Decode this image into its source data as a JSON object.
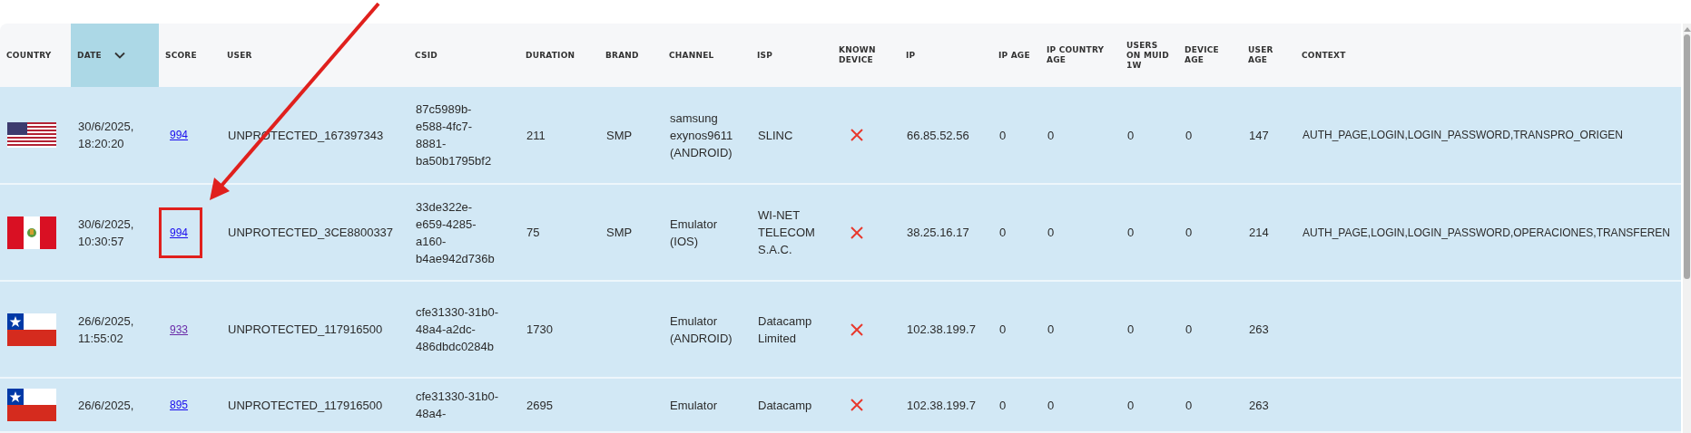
{
  "table": {
    "columns": [
      {
        "label": "COUNTRY",
        "sorted": false
      },
      {
        "label": "DATE",
        "sorted": true
      },
      {
        "label": "SCORE",
        "sorted": false
      },
      {
        "label": "USER",
        "sorted": false
      },
      {
        "label": "CSID",
        "sorted": false
      },
      {
        "label": "DURATION",
        "sorted": false
      },
      {
        "label": "BRAND",
        "sorted": false
      },
      {
        "label": "CHANNEL",
        "sorted": false
      },
      {
        "label": "ISP",
        "sorted": false
      },
      {
        "label": "KNOWN DEVICE",
        "sorted": false
      },
      {
        "label": "IP",
        "sorted": false
      },
      {
        "label": "IP AGE",
        "sorted": false
      },
      {
        "label": "IP COUNTRY AGE",
        "sorted": false
      },
      {
        "label": "USERS ON MUID 1W",
        "sorted": false
      },
      {
        "label": "DEVICE AGE",
        "sorted": false
      },
      {
        "label": "USER AGE",
        "sorted": false
      },
      {
        "label": "CONTEXT",
        "sorted": false
      }
    ],
    "rows": [
      {
        "flag": {
          "kind": "us"
        },
        "date": "30/6/2025, 18:20:20",
        "score": {
          "text": "994",
          "visited": false,
          "highlighted": false
        },
        "user": "UNPROTECTED_167397343",
        "csid": "87c5989b-e588-4fc7-8881-ba50b1795bf2",
        "duration": "211",
        "brand": "SMP",
        "channel": "samsung exynos9611 (ANDROID)",
        "isp": "SLINC",
        "known_device": false,
        "ip": "66.85.52.56",
        "ip_age": "0",
        "ip_country_age": "0",
        "users_on_muid_1w": "0",
        "device_age": "0",
        "user_age": "147",
        "context": "AUTH_PAGE,LOGIN,LOGIN_PASSWORD,TRANSPRO_ORIGEN"
      },
      {
        "flag": {
          "kind": "pe"
        },
        "date": "30/6/2025, 10:30:57",
        "score": {
          "text": "994",
          "visited": false,
          "highlighted": true
        },
        "user": "UNPROTECTED_3CE8800337",
        "csid": "33de322e-e659-4285-a160-b4ae942d736b",
        "duration": "75",
        "brand": "SMP",
        "channel": "Emulator (IOS)",
        "isp": "WI-NET TELECOM S.A.C.",
        "known_device": false,
        "ip": "38.25.16.17",
        "ip_age": "0",
        "ip_country_age": "0",
        "users_on_muid_1w": "0",
        "device_age": "0",
        "user_age": "214",
        "context": "AUTH_PAGE,LOGIN,LOGIN_PASSWORD,OPERACIONES,TRANSFEREN"
      },
      {
        "flag": {
          "kind": "cl"
        },
        "date": "26/6/2025, 11:55:02",
        "score": {
          "text": "933",
          "visited": true,
          "highlighted": false
        },
        "user": "UNPROTECTED_117916500",
        "csid": "cfe31330-31b0-48a4-a2dc-486dbdc0284b",
        "duration": "1730",
        "channel": "Emulator (ANDROID)",
        "isp": "Datacamp Limited",
        "known_device": false,
        "ip": "102.38.199.7",
        "ip_age": "0",
        "ip_country_age": "0",
        "users_on_muid_1w": "0",
        "device_age": "0",
        "user_age": "263"
      },
      {
        "flag": {
          "kind": "cl"
        },
        "date": "26/6/2025,",
        "score": {
          "text": "895",
          "visited": false,
          "highlighted": false
        },
        "user": "UNPROTECTED_117916500",
        "csid": "cfe31330-31b0-48a4-",
        "duration": "2695",
        "channel": "Emulator",
        "isp": "Datacamp",
        "known_device": false,
        "ip": "102.38.199.7",
        "ip_age": "0",
        "ip_country_age": "0",
        "users_on_muid_1w": "0",
        "device_age": "0",
        "user_age": "263"
      }
    ]
  }
}
